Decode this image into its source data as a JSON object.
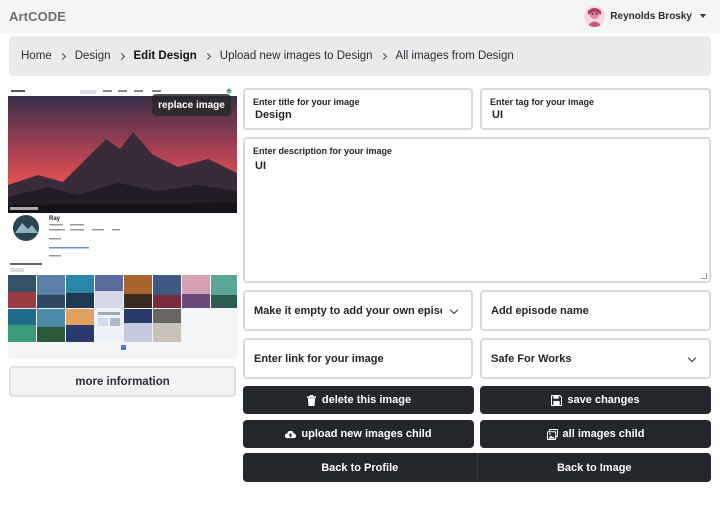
{
  "nav": {
    "brand": "ArtCODE",
    "user_name": "Reynolds Brosky"
  },
  "breadcrumb": {
    "items": [
      "Home",
      "Design",
      "Edit Design",
      "Upload new images to Design",
      "All images from Design"
    ],
    "active_index": 2
  },
  "preview": {
    "replace_label": "replace image",
    "profile_name": "Ray",
    "more_label": "more information"
  },
  "form": {
    "title_label": "Enter title for your image",
    "title_value": "Design",
    "tag_label": "Enter tag for your image",
    "tag_value": "UI",
    "description_label": "Enter description for your image",
    "description_value": "UI",
    "episode_select": "Make it empty to add your own episode",
    "episode_name_placeholder": "Add episode name",
    "link_placeholder": "Enter link for your image",
    "safety_select": "Safe For Works"
  },
  "buttons": {
    "delete_label": "delete this image",
    "save_label": "save changes",
    "upload_child_label": "upload new images child",
    "all_child_label": "all images child",
    "back_profile_label": "Back to Profile",
    "back_image_label": "Back to Image"
  },
  "colors": {
    "dark_button": "#23272b",
    "navbar_bg": "#f5f5f6",
    "breadcrumb_bg": "#e9eaeb",
    "sky_top": "#3a2f4a",
    "sky_glow": "#e4514f"
  },
  "icons": {
    "delete": "trash-icon",
    "save": "floppy-disk-icon",
    "upload": "cloud-upload-icon",
    "all_images": "images-icon"
  }
}
